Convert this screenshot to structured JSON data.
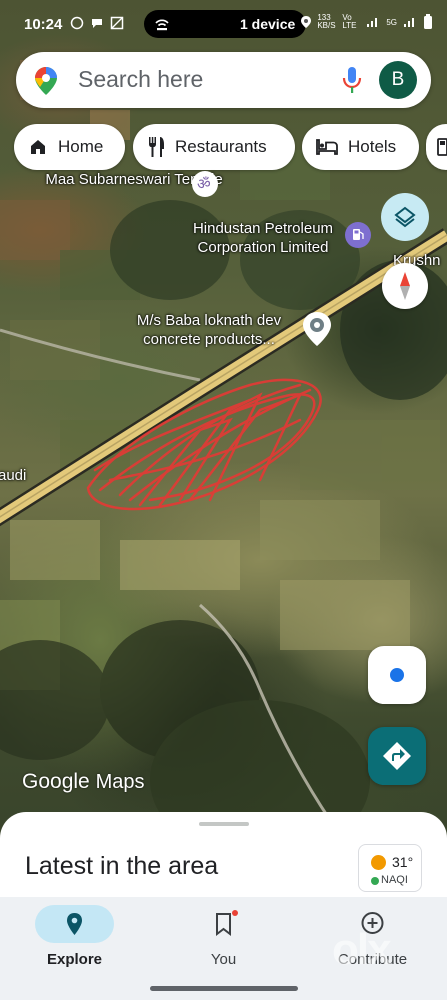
{
  "status_bar": {
    "time": "10:24",
    "cast_label": "1 device",
    "network_speed": "133 KB/S",
    "network_type": "Vo LTE",
    "net_5g": "5G"
  },
  "search": {
    "placeholder": "Search here",
    "avatar_letter": "B"
  },
  "chips": [
    {
      "label": "Home",
      "icon": "home-icon"
    },
    {
      "label": "Restaurants",
      "icon": "fork-knife-icon"
    },
    {
      "label": "Hotels",
      "icon": "bed-icon"
    }
  ],
  "map": {
    "labels": {
      "temple": "Maa Subarneswari Temple",
      "petroleum": "Hindustan Petroleum Corporation Limited",
      "concrete": "M/s Baba loknath dev concrete products...",
      "krushn": "Krushn",
      "audi": "audi"
    },
    "drawing_color": "#e53935",
    "road_color": "#e3c97a"
  },
  "attribution": {
    "google": "Google",
    "maps": "Maps"
  },
  "sheet": {
    "title": "Latest in the area",
    "weather_temp": "31°",
    "air_quality": "NAQI"
  },
  "bottom_nav": [
    {
      "label": "Explore",
      "active": true
    },
    {
      "label": "You",
      "active": false
    },
    {
      "label": "Contribute",
      "active": false
    }
  ],
  "watermark": "olx"
}
